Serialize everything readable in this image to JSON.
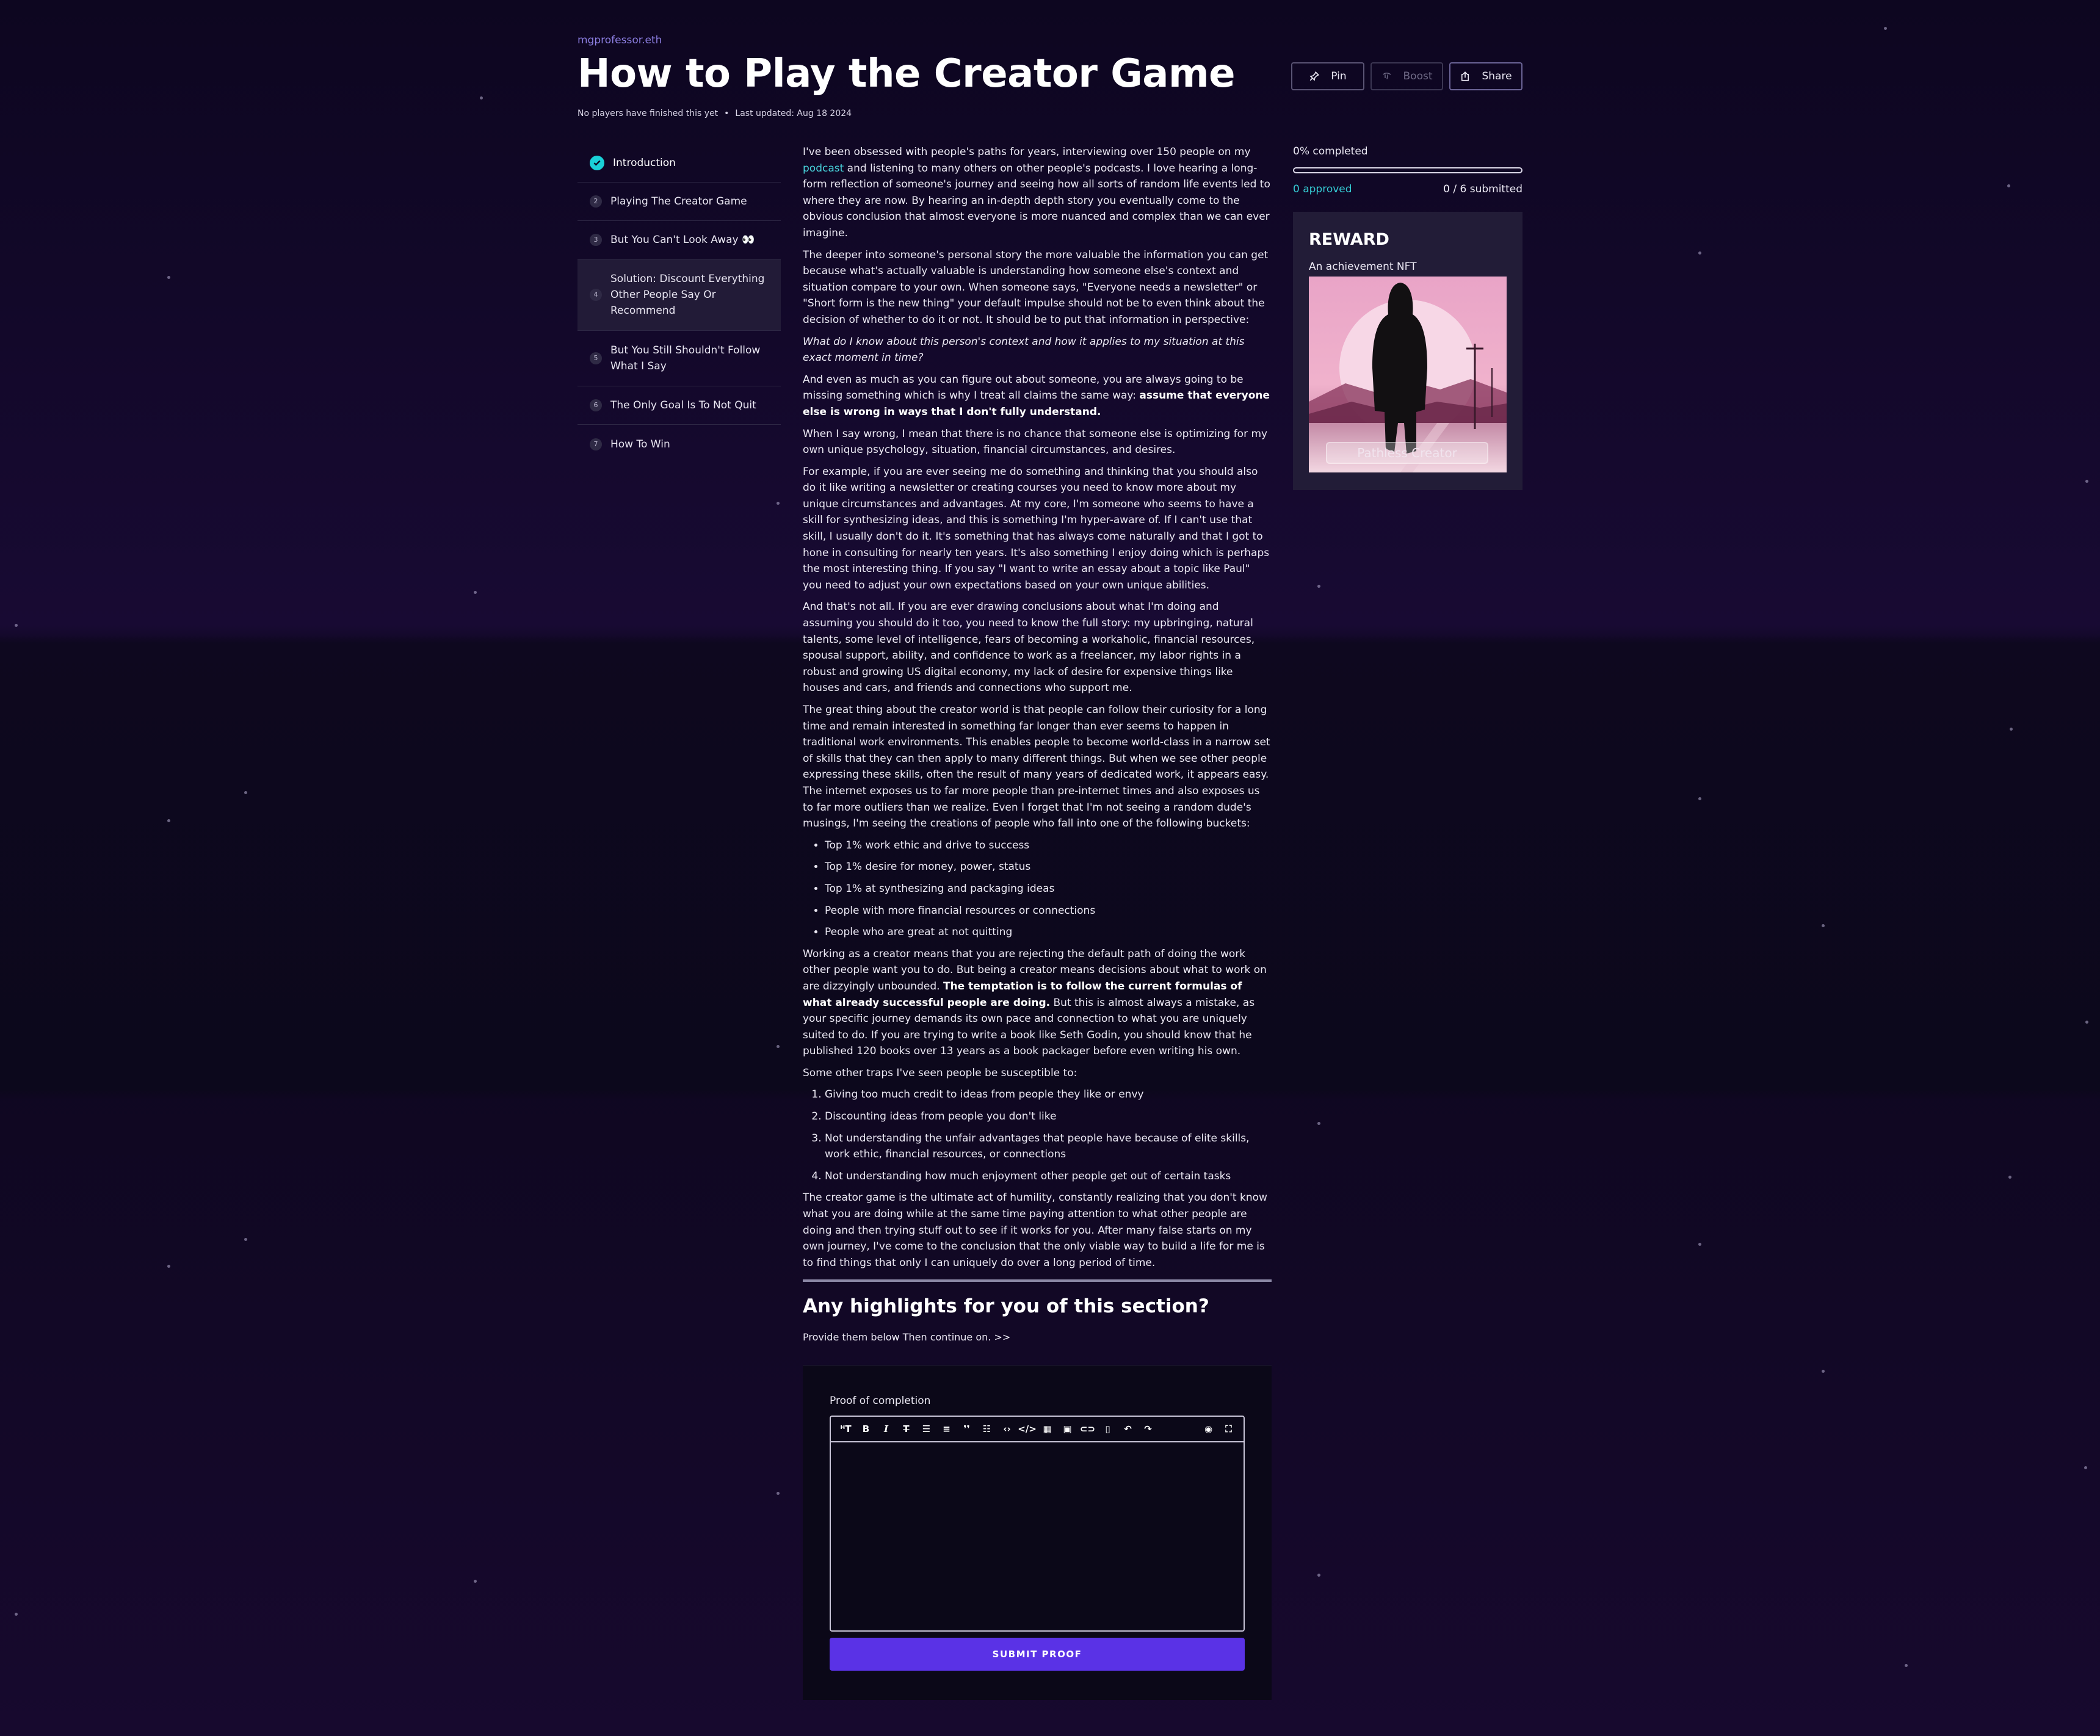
{
  "header": {
    "author": "mgprofessor.eth",
    "title": "How to Play the Creator Game",
    "players_status": "No players have finished this yet",
    "last_updated": "Last updated: Aug 18 2024",
    "pin_label": "Pin",
    "boost_label": "Boost",
    "share_label": "Share"
  },
  "toc": {
    "items": [
      {
        "num": "1",
        "label": "Introduction",
        "state": "done"
      },
      {
        "num": "2",
        "label": "Playing The Creator Game"
      },
      {
        "num": "3",
        "label": "But You Can't Look Away 👀"
      },
      {
        "num": "4",
        "label": "Solution: Discount Everything Other People Say Or Recommend",
        "state": "active"
      },
      {
        "num": "5",
        "label": "But You Still Shouldn't Follow What I Say"
      },
      {
        "num": "6",
        "label": "The Only Goal Is To Not Quit"
      },
      {
        "num": "7",
        "label": "How To Win"
      }
    ]
  },
  "article": {
    "p1_a": "I've been obsessed with people's paths for years, interviewing over 150 people on my ",
    "p1_link": "podcast",
    "p1_b": " and listening to many others on other people's podcasts. I love hearing a long-form reflection of someone's journey and seeing how all sorts of random life events led to where they are now. By hearing an in-depth depth story you eventually come to the obvious conclusion that almost everyone is more nuanced and complex than we can ever imagine.",
    "p2": "The deeper into someone's personal story the more valuable the information you can get because what's actually valuable is understanding how someone else's context and situation compare to your own. When someone says, \"Everyone needs a newsletter\" or \"Short form is the new thing\" your default impulse should not be to even think about the decision of whether to do it or not. It should be to put that information in perspective:",
    "p3": "What do I know about this person's context and how it applies to my situation at this exact moment in time?",
    "p4_a": "And even as much as you can figure out about someone, you are always going to be missing something which is why I treat all claims the same way: ",
    "p4_strong": "assume that everyone else is wrong in ways that I don't fully understand.",
    "p5": "When I say wrong, I mean that there is no chance that someone else is optimizing for my own unique psychology, situation, financial circumstances, and desires.",
    "p6": "For example, if you are ever seeing me do something and thinking that you should also do it like writing a newsletter or creating courses you need to know more about my unique circumstances and advantages. At my core, I'm someone who seems to have a skill for synthesizing ideas, and this is something I'm hyper-aware of. If I can't use that skill, I usually don't do it. It's something that has always come naturally and that I got to hone in consulting for nearly ten years. It's also something I enjoy doing which is perhaps the most interesting thing. If you say \"I want to write an essay about a topic like Paul\" you need to adjust your own expectations based on your own unique abilities.",
    "p7": "And that's not all. If you are ever drawing conclusions about what I'm doing and assuming you should do it too, you need to know the full story: my upbringing, natural talents, some level of intelligence, fears of becoming a workaholic, financial resources, spousal support, ability, and confidence to work as a freelancer, my labor rights in a robust and growing US digital economy, my lack of desire for expensive things like houses and cars, and friends and connections who support me.",
    "p8": "The great thing about the creator world is that people can follow their curiosity for a long time and remain interested in something far longer than ever seems to happen in traditional work environments. This enables people to become world-class in a narrow set of skills that they can then apply to many different things. But when we see other people expressing these skills, often the result of many years of dedicated work, it appears easy. The internet exposes us to far more people than pre-internet times and also exposes us to far more outliers than we realize. Even I forget that I'm not seeing a random dude's musings, I'm seeing the creations of people who fall into one of the following buckets:",
    "bullets": [
      "Top 1% work ethic and drive to success",
      "Top 1% desire for money, power, status",
      "Top 1% at synthesizing and packaging ideas",
      "People with more financial resources or connections",
      "People who are great at not quitting"
    ],
    "p9_a": "Working as a creator means that you are rejecting the default path of doing the work other people want you to do. But being a creator means decisions about what to work on are dizzyingly unbounded. ",
    "p9_strong": "The temptation is to follow the current formulas of what already successful people are doing.",
    "p9_b": " But this is almost always a mistake, as your specific journey demands its own pace and connection to what you are uniquely suited to do. If you are trying to write a book like Seth Godin, you should know that he published 120 books over 13 years as a book packager before even writing his own.",
    "p10": "Some other traps I've seen people be susceptible to:",
    "traps": [
      "Giving too much credit to ideas from people they like or envy",
      "Discounting ideas from people you don't like",
      "Not understanding the unfair advantages that people have because of elite skills, work ethic, financial resources, or connections",
      "Not understanding how much enjoyment other people get out of certain tasks"
    ],
    "p11": "The creator game is the ultimate act of humility, constantly realizing that you don't know what you are doing while at the same time paying attention to what other people are doing and then trying stuff out to see if it works for you. After many false starts on my own journey, I've come to the conclusion that the only viable way to build a life for me is to find things that only I can uniquely do over a long period of time.",
    "highlights_title": "Any highlights for you of this section?",
    "highlights_sub": "Provide them below Then continue on. >>"
  },
  "proof": {
    "label": "Proof of completion",
    "editor_value": "",
    "toolbar": [
      "heading-icon",
      "bold-icon",
      "italic-icon",
      "strikethrough-icon",
      "bullet-list-icon",
      "numbered-list-icon",
      "quote-icon",
      "checklist-icon",
      "code-icon",
      "code-block-icon",
      "table-icon",
      "image-icon",
      "link-icon",
      "clear-icon",
      "undo-icon",
      "redo-icon",
      "preview-icon",
      "fullscreen-icon"
    ],
    "submit_label": "SUBMIT PROOF"
  },
  "progress": {
    "completed_label": "0% completed",
    "fraction": 0,
    "approved_label": "0 approved",
    "submitted_label": "0 / 6 submitted"
  },
  "reward": {
    "title": "REWARD",
    "subtitle": "An achievement NFT",
    "nft_name": "Pathless Creator"
  },
  "colors": {
    "accent_cyan": "#1ad1d8",
    "submit_purple": "#5a32e6",
    "author_purple": "#8d7fe3",
    "background": "#120827"
  }
}
